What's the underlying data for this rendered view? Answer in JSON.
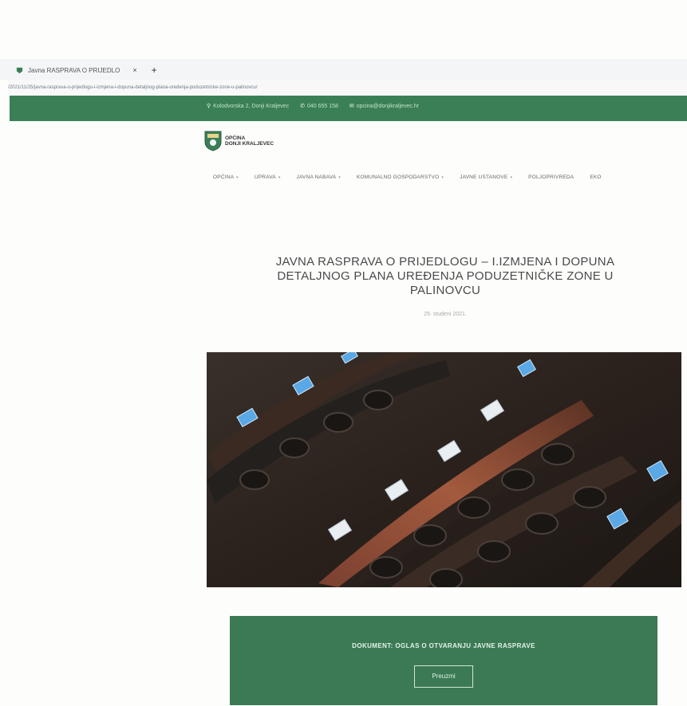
{
  "browser": {
    "tab_title": "Javna RASPRAVA O PRIJEDLO",
    "close_glyph": "×",
    "new_tab_glyph": "+",
    "url": "/2021/11/25/javna-rasprava-o-prijedlogu-i-izmjena-i-dopuna-detaljnog-plana-uredenja-poduzetnicke-zone-u-palinovcu/"
  },
  "topbar": {
    "address": "Kolodvorska 2, Donji Kraljevec",
    "phone": "040 655 158",
    "email": "opcina@donjikraljevec.hr"
  },
  "logo": {
    "line1": "OPĆINA",
    "line2": "DONJI KRALJEVEC"
  },
  "menu": [
    {
      "label": "OPĆINA",
      "has_dropdown": true
    },
    {
      "label": "UPRAVA",
      "has_dropdown": true
    },
    {
      "label": "JAVNA NABAVA",
      "has_dropdown": true
    },
    {
      "label": "KOMUNALNO GOSPODARSTVO",
      "has_dropdown": true
    },
    {
      "label": "JAVNE USTANOVE",
      "has_dropdown": true
    },
    {
      "label": "POLJOPRIVREDA",
      "has_dropdown": false
    },
    {
      "label": "EKO",
      "has_dropdown": false
    }
  ],
  "article": {
    "title": "JAVNA RASPRAVA O PRIJEDLOGU – I.IZMJENA I DOPUNA DETALJNOG PLANA UREĐENJA PODUZETNIČKE ZONE U PALINOVCU",
    "date": "29. studeni 2021."
  },
  "document": {
    "label": "DOKUMENT: OGLAS O OTVARANJU JAVNE RASPRAVE",
    "button": "Preuzmi"
  },
  "colors": {
    "brand_green": "#3b7f56",
    "doc_green": "#3b7a55"
  }
}
